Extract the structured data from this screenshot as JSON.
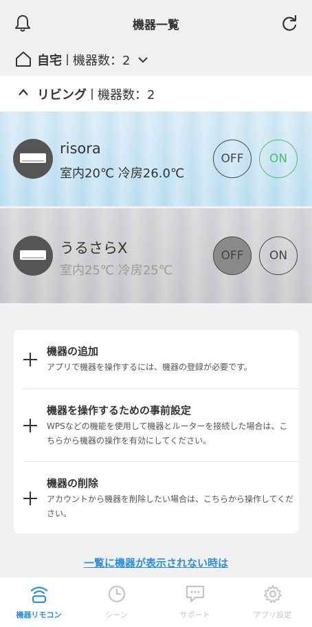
{
  "header": {
    "title": "機器一覧",
    "icons": [
      "bell-icon",
      "refresh-icon"
    ]
  },
  "home": {
    "icon": "house-icon",
    "name": "自宅",
    "count_label": "機器数：2"
  },
  "group": {
    "icon": "chevron-up-icon",
    "name": "リビング",
    "count_label": "機器数：2"
  },
  "devices": [
    {
      "name": "risora",
      "status": "室内20℃ 冷房26.0℃",
      "power": "on",
      "off_label": "OFF",
      "on_label": "ON"
    },
    {
      "name": "うるさらX",
      "status": "室内25℃ 冷房25℃",
      "power": "off",
      "off_label": "OFF",
      "on_label": "ON"
    }
  ],
  "actions": [
    {
      "title": "機器の追加",
      "description": "アプリで機器を操作するには、機器の登録が必要です。"
    },
    {
      "title": "機器を操作するための事前設定",
      "description": "WPSなどの機能を使用して機器とルーターを接続した場合は、こちらから機器の操作を有効にしてください。"
    },
    {
      "title": "機器の削除",
      "description": "アカウントから機器を削除したい場合は、こちらから操作してください。"
    }
  ],
  "help_link": "一覧に機器が表示されない時は",
  "tabs": [
    {
      "label": "機器リモコン",
      "icon": "wifi-remote-icon",
      "active": true
    },
    {
      "label": "シーン",
      "icon": "clock-icon",
      "active": false
    },
    {
      "label": "サポート",
      "icon": "chat-icon",
      "active": false
    },
    {
      "label": "アプリ設定",
      "icon": "gear-icon",
      "active": false
    }
  ],
  "colors": {
    "accent": "#2e8fd4",
    "on_green": "#4cbf62",
    "on_card": "#c4e1f2",
    "off_card": "#cbcbcf"
  }
}
